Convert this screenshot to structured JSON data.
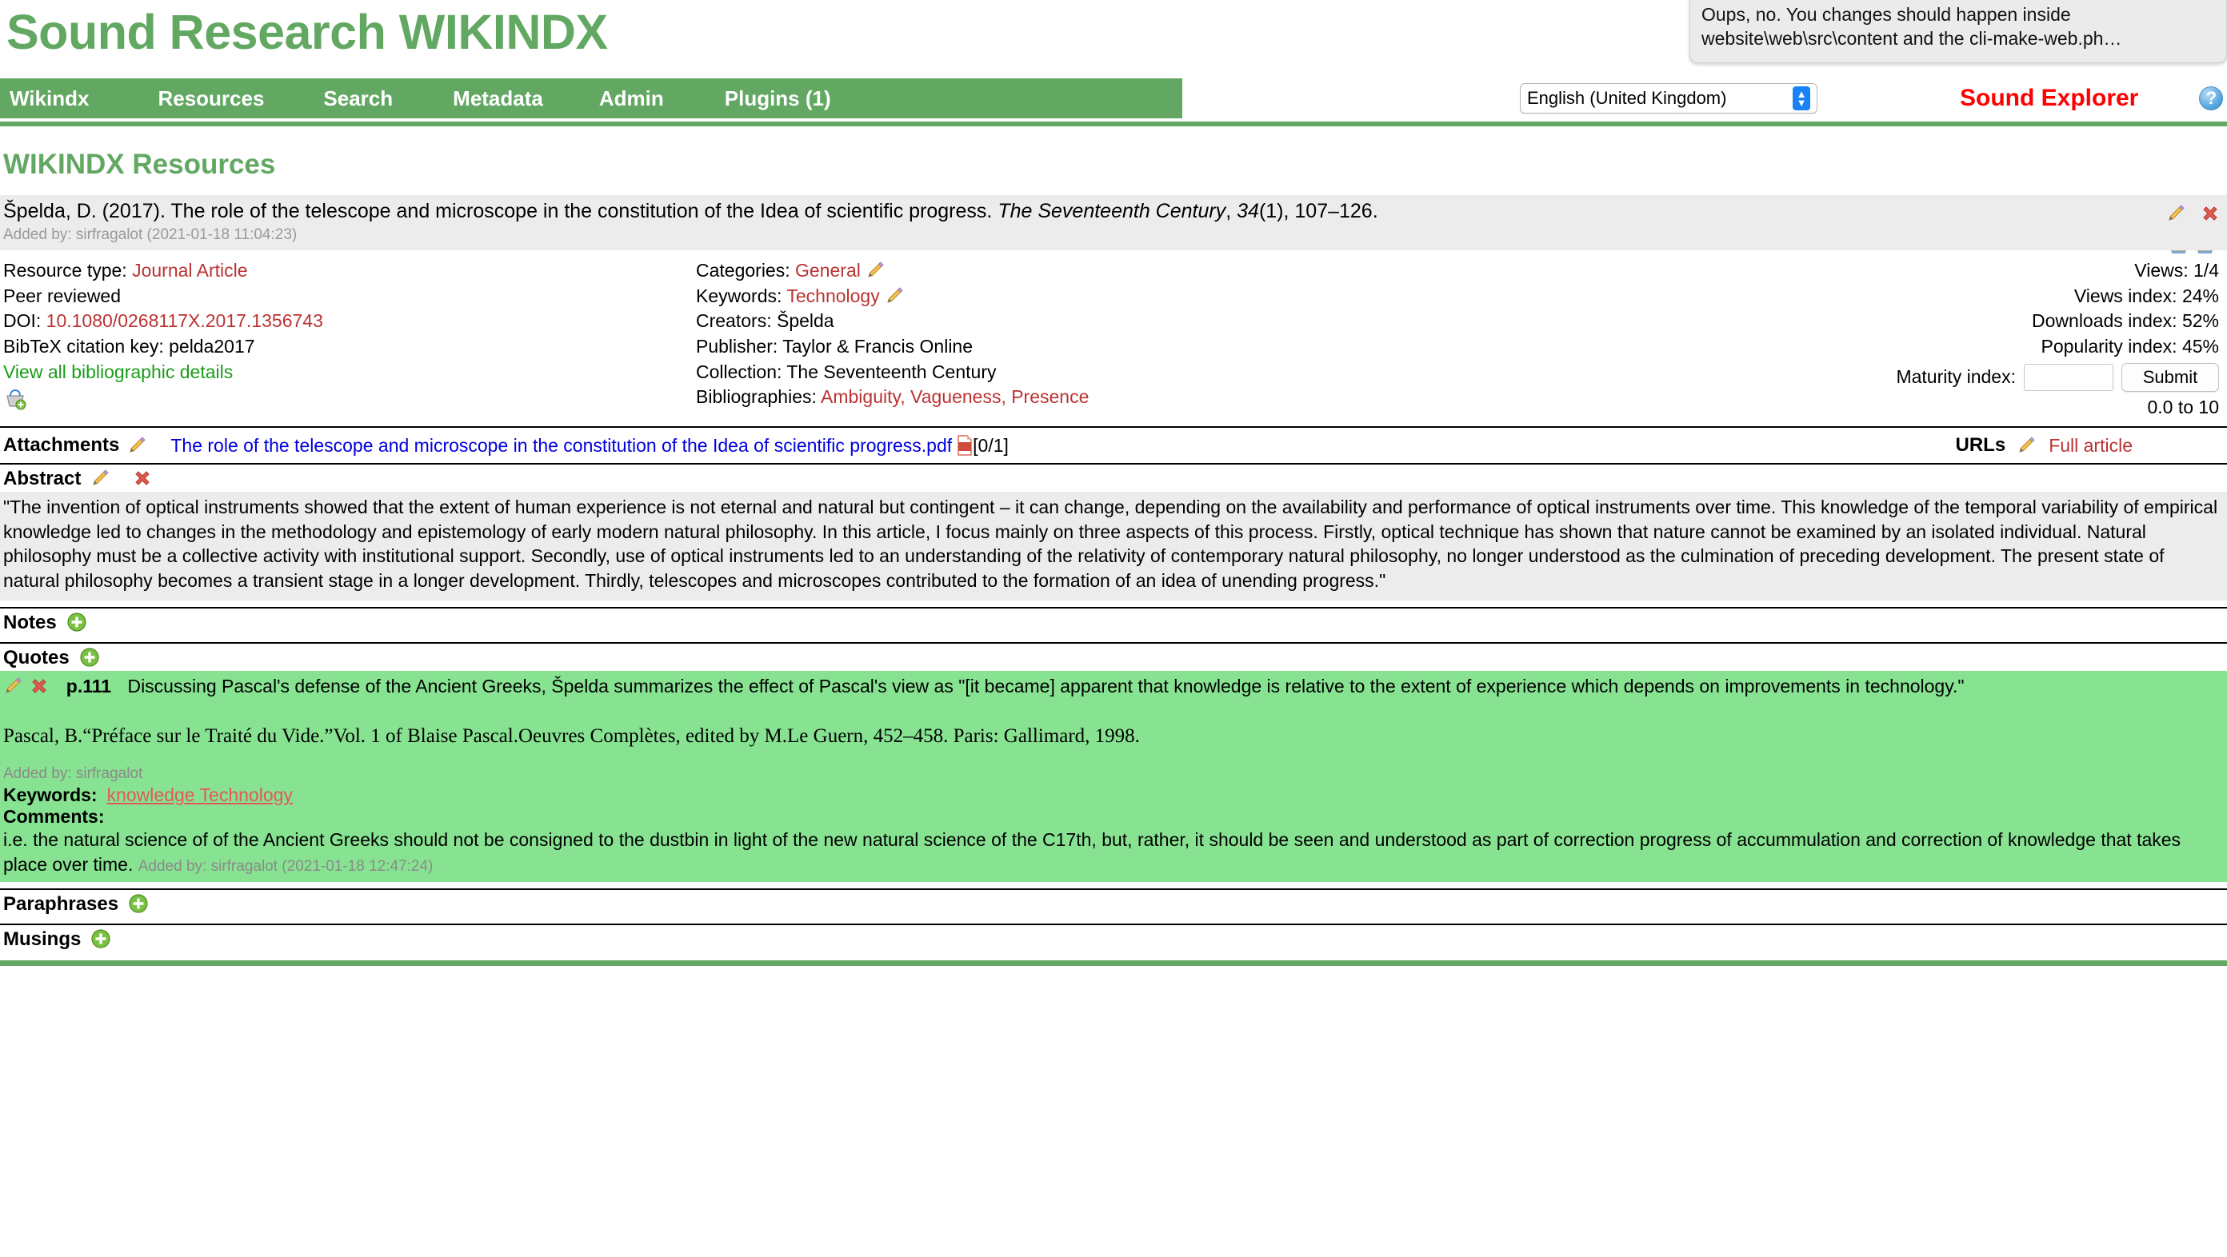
{
  "header": {
    "site_title": "Sound Research WIKINDX",
    "tooltip": "Oups, no. You changes should happen inside website\\web\\src\\content and the cli-make-web.ph…"
  },
  "nav": {
    "items": [
      {
        "label": "Wikindx"
      },
      {
        "label": "Resources"
      },
      {
        "label": "Search"
      },
      {
        "label": "Metadata"
      },
      {
        "label": "Admin"
      },
      {
        "label": "Plugins (1)"
      }
    ],
    "language_selected": "English (United Kingdom)",
    "user_link": "Sound Explorer",
    "help_glyph": "?"
  },
  "page": {
    "heading": "WIKINDX Resources"
  },
  "citation": {
    "author_year": "Špelda, D. (2017). ",
    "title": "The role of the telescope and microscope in the constitution of the Idea of scientific progress. ",
    "journal": "The Seventeenth Century",
    "comma": ", ",
    "volume": "34",
    "issue_pages": "(1), 107–126.",
    "added_by": "Added by: sirfragalot (2021-01-18 11:04:23)"
  },
  "details": {
    "resource_type_label": "Resource type: ",
    "resource_type_value": "Journal Article",
    "peer_reviewed": "Peer reviewed",
    "doi_label": "DOI: ",
    "doi_value": "10.1080/0268117X.2017.1356743",
    "bibtex_label": "BibTeX citation key: ",
    "bibtex_value": "pelda2017",
    "view_all": "View all bibliographic details",
    "categories_label": "Categories: ",
    "categories_value": "General",
    "keywords_label": "Keywords: ",
    "keywords_value": "Technology",
    "creators_label": "Creators: ",
    "creators_value": "Špelda",
    "publisher_label": "Publisher: ",
    "publisher_value": "Taylor & Francis Online",
    "collection_label": "Collection: ",
    "collection_value": "The Seventeenth Century",
    "bibliographies_label": "Bibliographies: ",
    "bibliographies_value": "Ambiguity, Vagueness, Presence"
  },
  "stats": {
    "views": "Views: 1/4",
    "views_index": "Views index: 24%",
    "downloads_index": "Downloads index: 52%",
    "popularity_index": "Popularity index: 45%",
    "maturity_label": "Maturity index:",
    "maturity_value": "",
    "submit_label": "Submit",
    "range_note": "0.0 to 10"
  },
  "attachments": {
    "label": "Attachments",
    "file_name": "The role of the telescope and microscope in the constitution of the Idea of scientific progress.pdf",
    "count": "[0/1]",
    "urls_label": "URLs",
    "url_value": "Full article"
  },
  "abstract": {
    "label": "Abstract",
    "text": "\"The invention of optical instruments showed that the extent of human experience is not eternal and natural but contingent – it can change, depending on the availability and performance of optical instruments over time. This knowledge of the temporal variability of empirical knowledge led to changes in the methodology and epistemology of early modern natural philosophy. In this article, I focus mainly on three aspects of this process. Firstly, optical technique has shown that nature cannot be examined by an isolated individual. Natural philosophy must be a collective activity with institutional support. Secondly, use of optical instruments led to an understanding of the relativity of contemporary natural philosophy, no longer understood as the culmination of preceding development. The present state of natural philosophy becomes a transient stage in a longer development. Thirdly, telescopes and microscopes contributed to the formation of an idea of unending progress.\""
  },
  "sections": {
    "notes_label": "Notes",
    "quotes_label": "Quotes",
    "paraphrases_label": "Paraphrases",
    "musings_label": "Musings"
  },
  "quote": {
    "page": "p.111",
    "text": "Discussing Pascal's defense of the Ancient Greeks, Špelda summarizes the effect of Pascal's view as \"[it became] apparent that knowledge is relative to the extent of experience which depends on improvements in technology.\"",
    "citation": "Pascal, B.“Préface sur le Traité du Vide.”Vol. 1 of Blaise Pascal.Oeuvres Complètes, edited by M.Le Guern, 452–458. Paris: Gallimard, 1998.",
    "added_by": "Added by: sirfragalot",
    "keywords_label": "Keywords:",
    "keywords_value": "knowledge Technology",
    "comments_label": "Comments:",
    "comments_text": "i.e. the natural science of of the Ancient Greeks should not be consigned to the dustbin in light of the new natural science of the C17th, but, rather, it should be seen and understood as part of correction progress of accummulation and correction of knowledge that takes place over time.",
    "comments_added_by": "Added by: sirfragalot  (2021-01-18 12:47:24)"
  },
  "colors": {
    "brand_green": "#62a862",
    "quote_green": "#87e391",
    "link_red": "#bb3333",
    "accent_red": "#ff0000"
  }
}
